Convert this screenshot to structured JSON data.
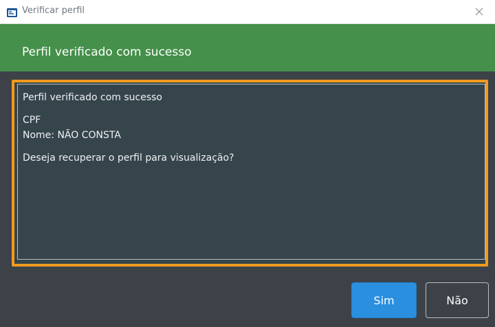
{
  "window": {
    "title": "Verificar perfil"
  },
  "header": {
    "title": "Perfil verificado com sucesso"
  },
  "message": {
    "line1": "Perfil verificado com sucesso",
    "line2": "CPF",
    "line3": "Nome: NÃO CONSTA",
    "line4": "Deseja recuperar o perfil para visualização?"
  },
  "buttons": {
    "yes_label": "Sim",
    "no_label": "Não"
  },
  "icons": {
    "app": "app-window-icon",
    "close": "close-icon"
  },
  "colors": {
    "header_bg": "#45904a",
    "highlight": "#f39a1f",
    "primary_button": "#2b8fe0"
  }
}
